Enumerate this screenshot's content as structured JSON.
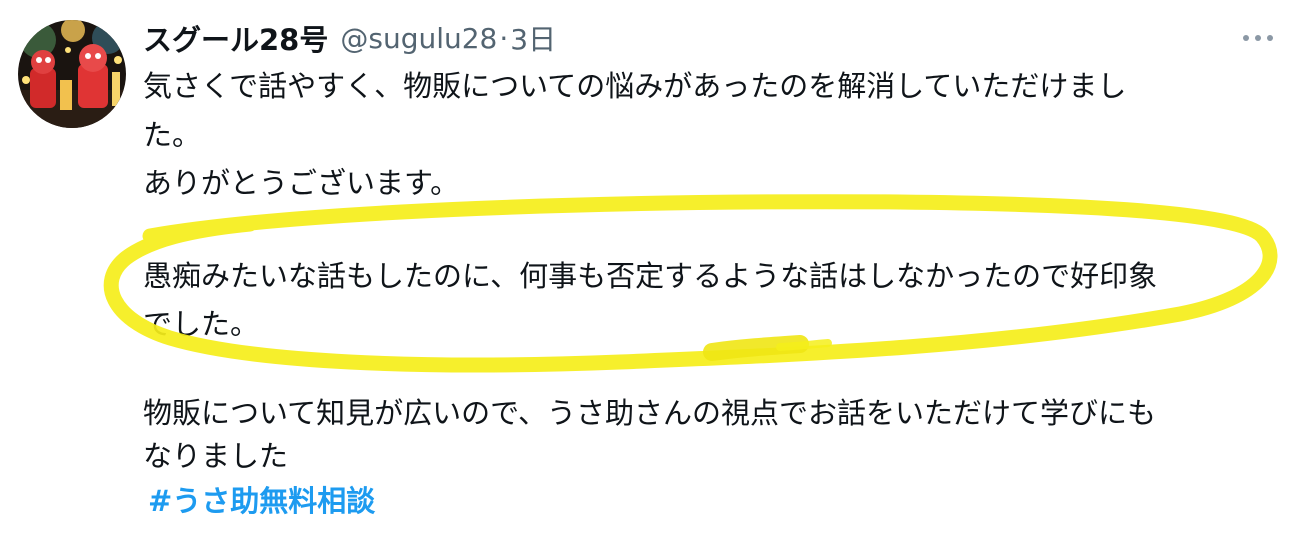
{
  "user": {
    "display_name": "スグール28号",
    "handle": "@sugulu28",
    "separator": "·",
    "time": "3日",
    "avatar_icon": "user-avatar"
  },
  "tweet": {
    "lines": [
      "気さくで話やすく、物販についての悩みがあったのを解消していただけまし",
      "た。",
      "ありがとうございます。",
      "愚痴みたいな話もしたのに、何事も否定するような話はしなかったので好印象",
      "でした。",
      "物販について知見が広いので、うさ助さんの視点でお話をいただけて学びにも",
      "なりました"
    ],
    "hashtag": "#うさ助無料相談"
  },
  "icons": {
    "more": "more-options-icon"
  },
  "colors": {
    "text": "#0f1419",
    "secondary": "#536471",
    "link": "#1d9bf0",
    "highlight_marker": "#f5ee1a"
  }
}
